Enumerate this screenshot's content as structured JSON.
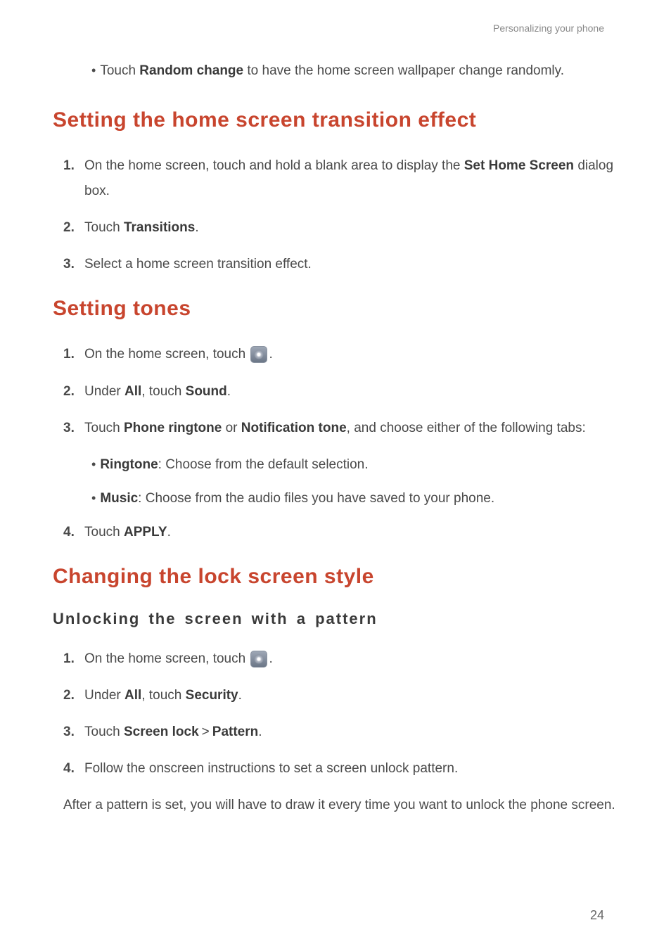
{
  "header": "Personalizing your phone",
  "intro_bullet": {
    "prefix": "Touch ",
    "bold": "Random change",
    "suffix": " to have the home screen wallpaper change randomly."
  },
  "section1": {
    "heading": "Setting the home screen transition effect",
    "steps": {
      "s1": {
        "num": "1.",
        "prefix": "On the home screen, touch and hold a blank area to display the ",
        "bold": "Set Home Screen",
        "suffix": " dialog box."
      },
      "s2": {
        "num": "2.",
        "prefix": "Touch ",
        "bold": "Transitions",
        "suffix": "."
      },
      "s3": {
        "num": "3.",
        "text": "Select a home screen transition effect."
      }
    }
  },
  "section2": {
    "heading": "Setting tones",
    "steps": {
      "s1": {
        "num": "1.",
        "prefix": "On the home screen, touch ",
        "suffix": "."
      },
      "s2": {
        "num": "2.",
        "prefix": "Under ",
        "bold1": "All",
        "mid": ", touch ",
        "bold2": "Sound",
        "suffix": "."
      },
      "s3": {
        "num": "3.",
        "prefix": "Touch ",
        "bold1": "Phone ringtone",
        "mid1": " or ",
        "bold2": "Notification tone",
        "suffix": ", and choose either of the following tabs:"
      },
      "bullets": {
        "b1": {
          "bold": "Ringtone",
          "text": ": Choose from the default selection."
        },
        "b2": {
          "bold": "Music",
          "text": ": Choose from the audio files you have saved to your phone."
        }
      },
      "s4": {
        "num": "4.",
        "prefix": "Touch ",
        "bold": "APPLY",
        "suffix": "."
      }
    }
  },
  "section3": {
    "heading": "Changing the lock screen style",
    "subheading": "Unlocking the screen with a pattern",
    "steps": {
      "s1": {
        "num": "1.",
        "prefix": "On the home screen, touch ",
        "suffix": "."
      },
      "s2": {
        "num": "2.",
        "prefix": "Under ",
        "bold1": "All",
        "mid": ", touch ",
        "bold2": "Security",
        "suffix": "."
      },
      "s3": {
        "num": "3.",
        "prefix": "Touch ",
        "bold1": "Screen lock",
        "gt": ">",
        "bold2": "Pattern",
        "suffix": "."
      },
      "s4": {
        "num": "4.",
        "text": "Follow the onscreen instructions to set a screen unlock pattern."
      }
    },
    "paragraph": "After a pattern is set, you will have to draw it every time you want to unlock the phone screen."
  },
  "page_number": "24"
}
